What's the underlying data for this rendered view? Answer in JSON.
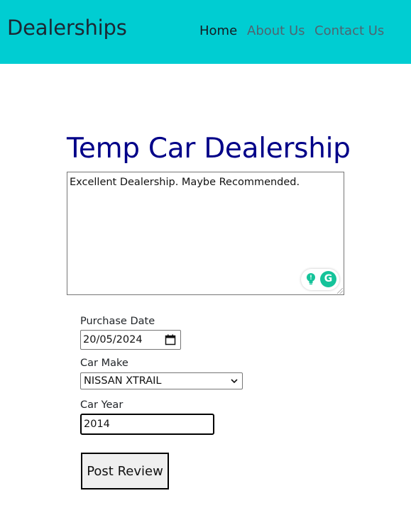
{
  "navbar": {
    "brand": "Dealerships",
    "links": [
      {
        "label": "Home",
        "active": true
      },
      {
        "label": "About Us",
        "active": false
      },
      {
        "label": "Contact Us",
        "active": false
      }
    ],
    "background_color": "#00cdd2"
  },
  "dealer": {
    "title": "Temp Car Dealership",
    "title_color": "#000088"
  },
  "review": {
    "text": "Excellent Dealership. Maybe Recommended.",
    "grammarly_badge": "G"
  },
  "form": {
    "purchase_date_label": "Purchase Date",
    "purchase_date_value": "20/05/2024",
    "car_make_label": "Car Make",
    "car_make_value": "NISSAN XTRAIL",
    "car_year_label": "Car Year",
    "car_year_value": "2014",
    "submit_label": "Post Review"
  },
  "icons": {
    "calendar": "calendar-icon",
    "dropdown": "chevron-down-icon",
    "grammarly": "grammarly-icon",
    "suggestion": "lightbulb-icon"
  }
}
